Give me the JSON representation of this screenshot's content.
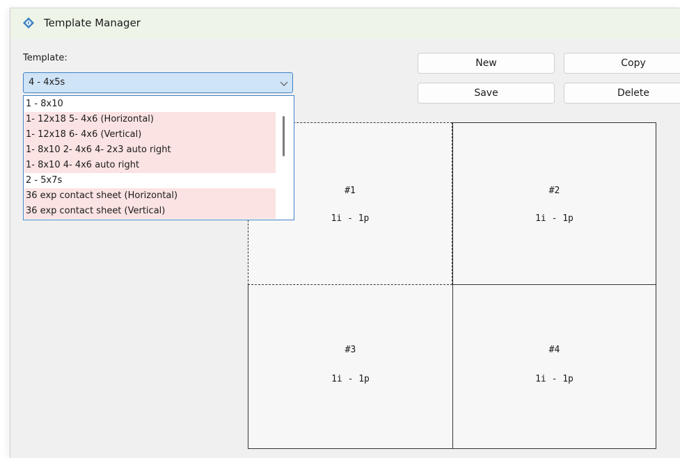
{
  "window": {
    "title": "Template Manager",
    "app_icon": "template-manager-app-icon"
  },
  "template": {
    "label": "Template:",
    "selected": "4 - 4x5s",
    "options": [
      {
        "label": "1 - 8x10",
        "highlight": false
      },
      {
        "label": "1- 12x18 5- 4x6 (Horizontal)",
        "highlight": true
      },
      {
        "label": "1- 12x18 6- 4x6 (Vertical)",
        "highlight": true
      },
      {
        "label": "1- 8x10 2- 4x6 4- 2x3 auto right",
        "highlight": true
      },
      {
        "label": "1- 8x10 4- 4x6 auto right",
        "highlight": true
      },
      {
        "label": "2 - 5x7s",
        "highlight": false
      },
      {
        "label": "36 exp contact sheet (Horizontal)",
        "highlight": true
      },
      {
        "label": "36 exp contact sheet (Vertical)",
        "highlight": true
      }
    ]
  },
  "buttons": {
    "new": "New",
    "copy": "Copy",
    "save": "Save",
    "delete": "Delete"
  },
  "layout": {
    "cells": [
      {
        "id": "#1",
        "info": "1i - 1p",
        "selected": true
      },
      {
        "id": "#2",
        "info": "1i - 1p",
        "selected": false
      },
      {
        "id": "#3",
        "info": "1i - 1p",
        "selected": false
      },
      {
        "id": "#4",
        "info": "1i - 1p",
        "selected": false
      }
    ]
  },
  "colors": {
    "accent": "#3e82c4",
    "titlebar": "#eef5e8",
    "highlight_row": "#fbe3e3",
    "select_bg": "#cfe4f6"
  }
}
